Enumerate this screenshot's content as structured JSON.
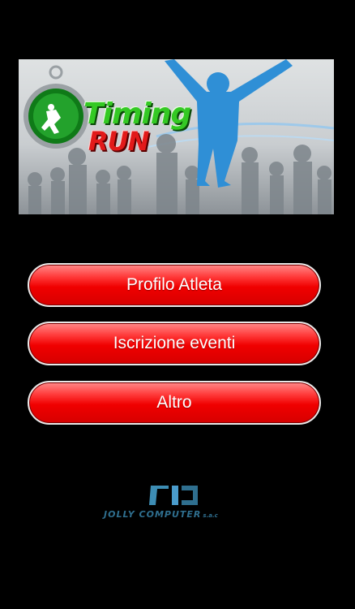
{
  "banner": {
    "logo_line1": "Timing",
    "logo_line2": "RUN"
  },
  "menu": {
    "items": [
      {
        "label": "Profilo Atleta"
      },
      {
        "label": "Iscrizione eventi"
      },
      {
        "label": "Altro"
      }
    ]
  },
  "footer": {
    "company_name": "JOLLY COMPUTER",
    "company_suffix": "s.a.c"
  },
  "colors": {
    "background": "#000000",
    "button_red": "#f00000",
    "logo_green": "#34c924",
    "logo_red": "#e21a1a",
    "company_blue": "#2f6f8f"
  }
}
